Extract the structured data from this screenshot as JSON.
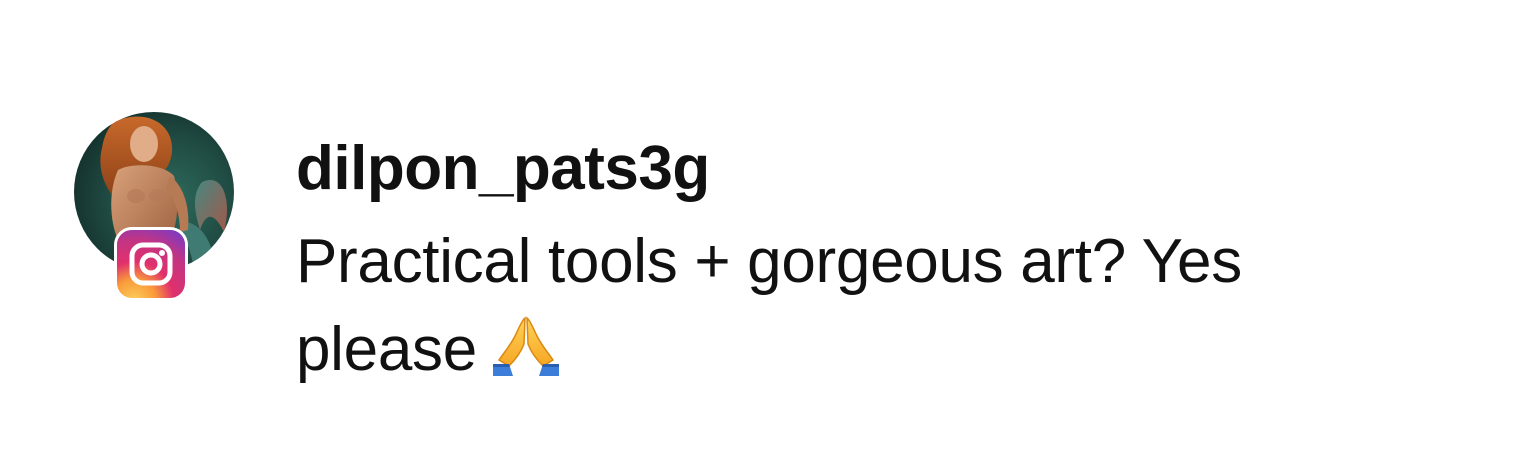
{
  "comment": {
    "username": "dilpon_pats3g",
    "text": "Practical tools + gorgeous art? Yes please",
    "emoji": "folded-hands-icon",
    "platform": "instagram-icon"
  },
  "colors": {
    "text": "#111111",
    "background": "#ffffff"
  }
}
